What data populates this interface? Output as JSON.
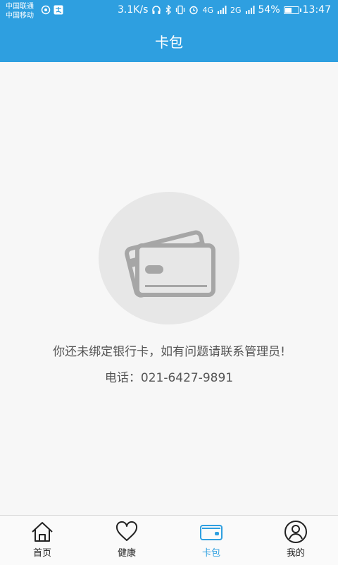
{
  "status_bar": {
    "carrier1": "中国联通",
    "carrier2": "中国移动",
    "speed": "3.1K/s",
    "signal1_label": "4G",
    "signal2_label": "2G",
    "battery_percent": "54%",
    "battery_level": 0.54,
    "time": "13:47",
    "icons": [
      "hotspot-icon",
      "alipay-icon",
      "headset-icon",
      "bluetooth-icon",
      "vibrate-icon",
      "alarm-icon",
      "signal-icon",
      "battery-icon"
    ]
  },
  "header": {
    "title": "卡包"
  },
  "empty_state": {
    "icon": "bank-cards-icon",
    "message": "你还未绑定银行卡，如有问题请联系管理员!",
    "phone": "电话：021-6427-9891"
  },
  "tabbar": {
    "items": [
      {
        "label": "首页",
        "icon": "home-icon",
        "active": false
      },
      {
        "label": "健康",
        "icon": "heart-icon",
        "active": false
      },
      {
        "label": "卡包",
        "icon": "wallet-icon",
        "active": true
      },
      {
        "label": "我的",
        "icon": "user-icon",
        "active": false
      }
    ]
  },
  "colors": {
    "primary": "#2e9fe0",
    "background": "#f7f7f7",
    "text": "#555555"
  }
}
